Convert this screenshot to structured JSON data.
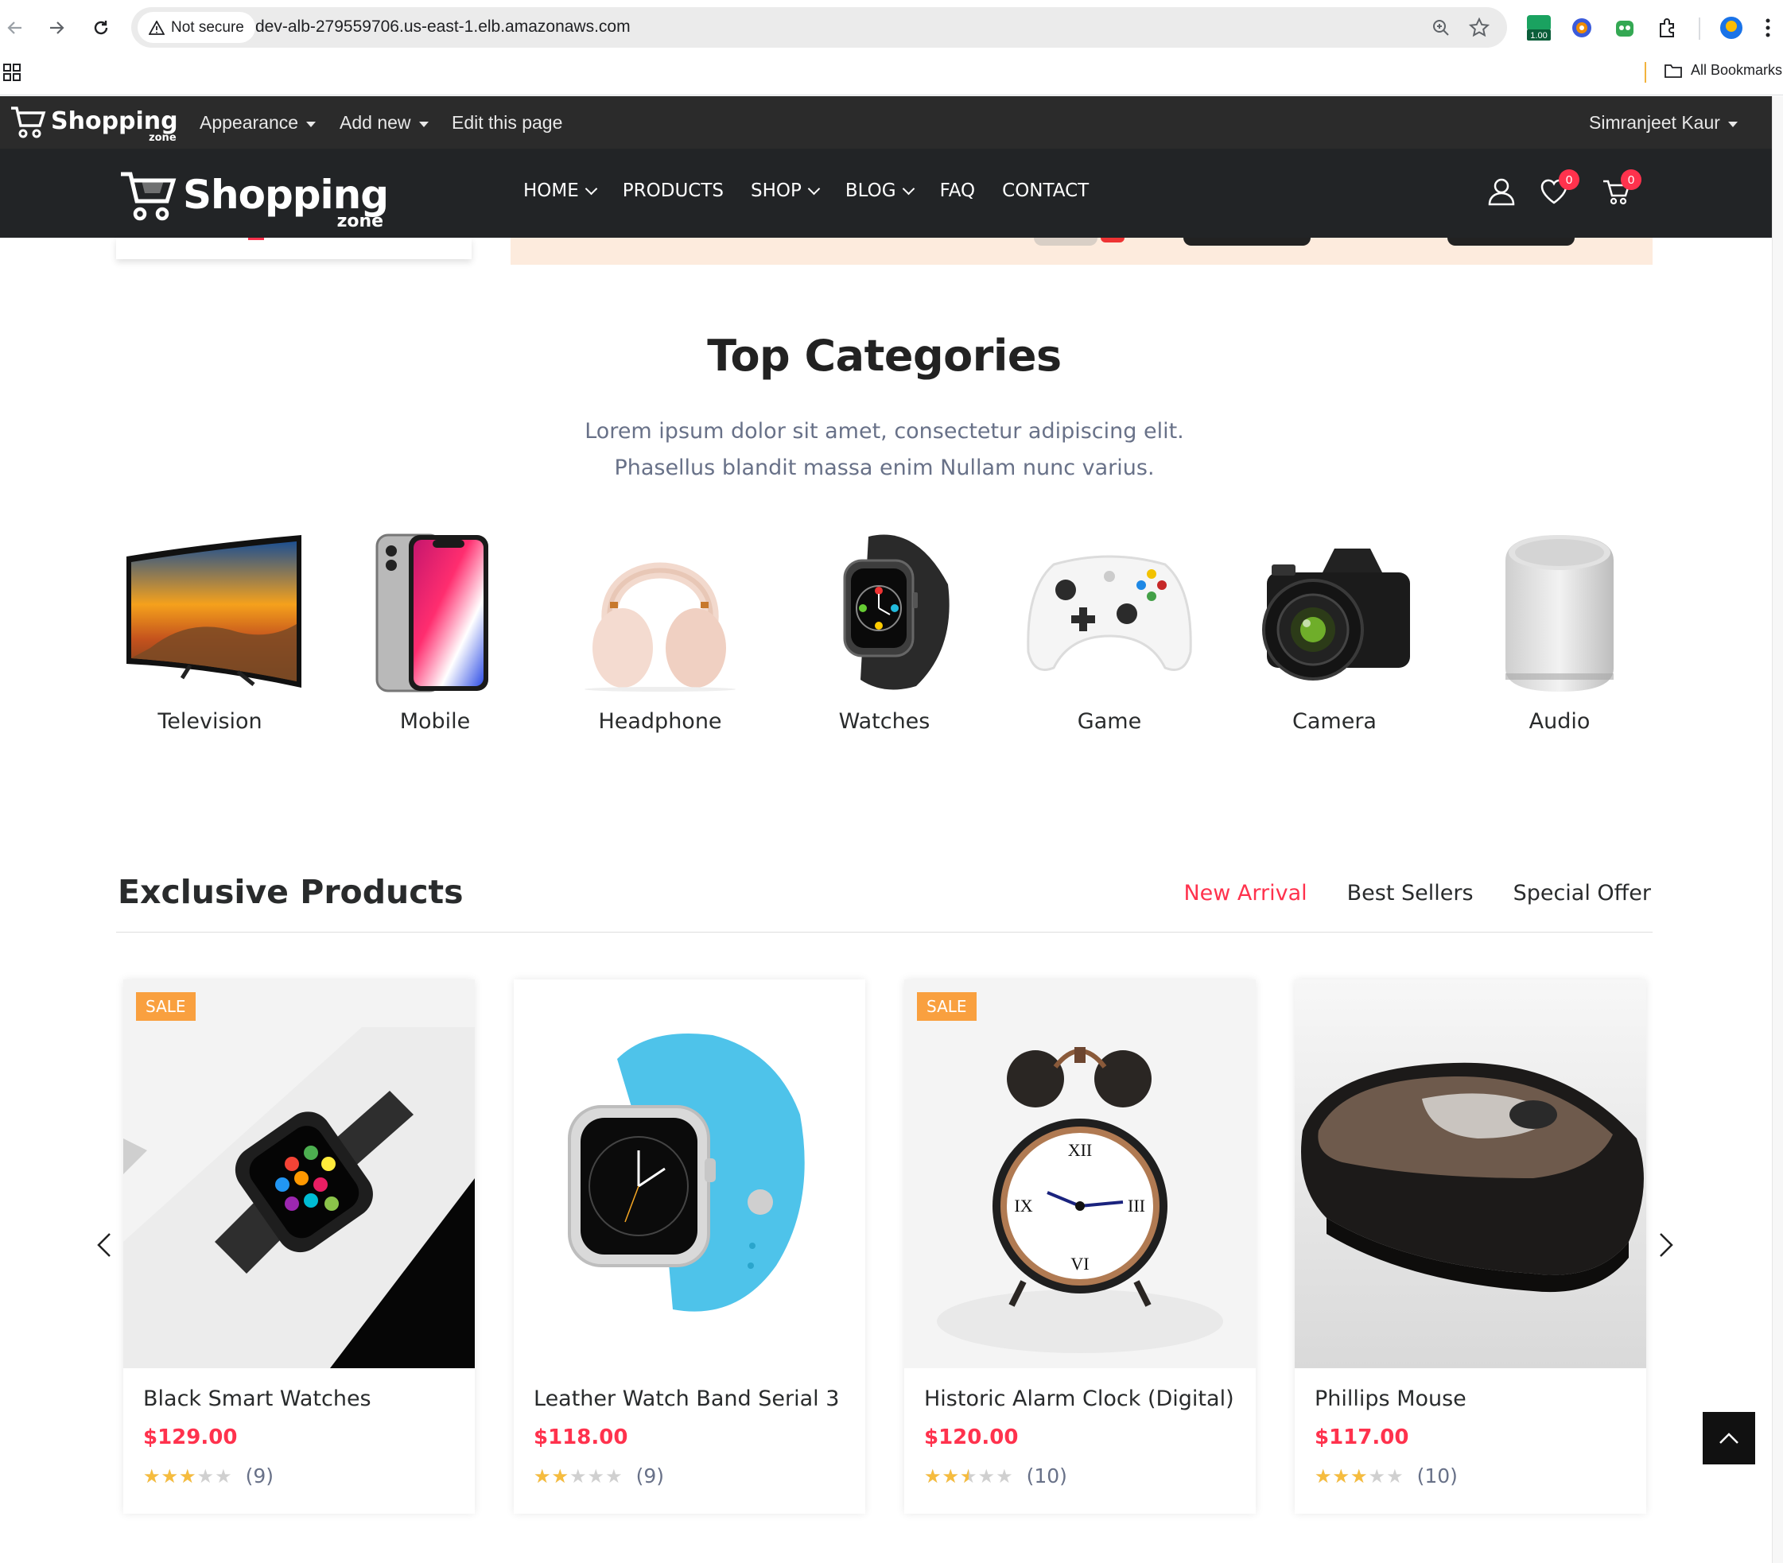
{
  "browser": {
    "security_label": "Not secure",
    "url": "dev-alb-279559706.us-east-1.elb.amazonaws.com",
    "extension_badge": "1.00",
    "all_bookmarks": "All Bookmarks"
  },
  "admin_bar": {
    "logo_text": "Shopping",
    "logo_sub": "zone",
    "appearance": "Appearance",
    "add_new": "Add new",
    "edit_page": "Edit this page",
    "user_name": "Simranjeet Kaur"
  },
  "header": {
    "logo_text": "Shopping",
    "logo_sub": "zone",
    "nav": [
      {
        "label": "HOME",
        "has_dropdown": true
      },
      {
        "label": "PRODUCTS",
        "has_dropdown": false
      },
      {
        "label": "SHOP",
        "has_dropdown": true
      },
      {
        "label": "BLOG",
        "has_dropdown": true
      },
      {
        "label": "FAQ",
        "has_dropdown": false
      },
      {
        "label": "CONTACT",
        "has_dropdown": false
      }
    ],
    "wishlist_count": "0",
    "cart_count": "0"
  },
  "categories_section": {
    "title": "Top Categories",
    "description": "Lorem ipsum dolor sit amet, consectetur adipiscing elit. Phasellus blandit massa enim Nullam nunc varius.",
    "items": [
      {
        "label": "Television",
        "icon": "television-image"
      },
      {
        "label": "Mobile",
        "icon": "mobile-image"
      },
      {
        "label": "Headphone",
        "icon": "headphone-image"
      },
      {
        "label": "Watches",
        "icon": "watch-image"
      },
      {
        "label": "Game",
        "icon": "game-controller-image"
      },
      {
        "label": "Camera",
        "icon": "camera-image"
      },
      {
        "label": "Audio",
        "icon": "speaker-image"
      }
    ]
  },
  "exclusive_section": {
    "title": "Exclusive Products",
    "tabs": [
      {
        "label": "New Arrival",
        "active": true
      },
      {
        "label": "Best Sellers",
        "active": false
      },
      {
        "label": "Special Offer",
        "active": false
      }
    ],
    "products": [
      {
        "name": "Black Smart Watches",
        "price": "$129.00",
        "rating": 3,
        "reviews": "(9)",
        "sale": "SALE"
      },
      {
        "name": "Leather Watch Band Serial 3",
        "price": "$118.00",
        "rating": 2,
        "reviews": "(9)",
        "sale": ""
      },
      {
        "name": "Historic Alarm Clock (Digital)",
        "price": "$120.00",
        "rating": 2.5,
        "reviews": "(10)",
        "sale": "SALE"
      },
      {
        "name": "Phillips Mouse",
        "price": "$117.00",
        "rating": 3,
        "reviews": "(10)",
        "sale": ""
      }
    ]
  },
  "colors": {
    "accent": "#ff324d",
    "sale_badge": "#f9a03f",
    "header_bg": "#222426",
    "admin_bg": "#2b2b2b",
    "star": "#f6bc3e"
  }
}
